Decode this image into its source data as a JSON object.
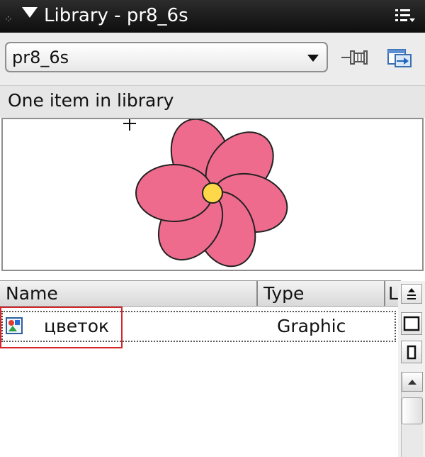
{
  "panel": {
    "title": "Library - pr8_6s"
  },
  "toolbar": {
    "selected_library": "pr8_6s",
    "pin_icon": "pin-icon",
    "new_library_icon": "new-library-panel-icon"
  },
  "status": {
    "item_count_text": "One item in library"
  },
  "preview": {
    "symbol": "flower-graphic",
    "petal_color": "#ee6b8d",
    "center_color": "#ffd84a"
  },
  "list": {
    "columns": [
      "Name",
      "Type",
      "L"
    ],
    "items": [
      {
        "name": "цветок",
        "type": "Graphic",
        "icon": "graphic-symbol-icon"
      }
    ]
  },
  "colors": {
    "highlight": "#d7262a",
    "titlebar": "#1a1a1a"
  }
}
